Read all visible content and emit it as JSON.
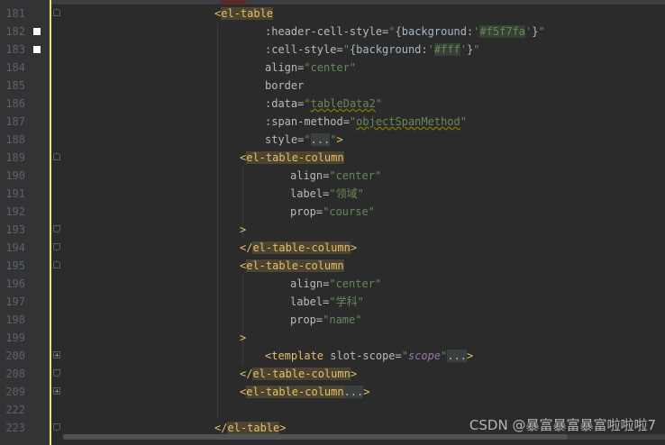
{
  "lines": [
    {
      "num": "181",
      "indent": "",
      "parts": [
        {
          "t": "<",
          "c": "tag"
        },
        {
          "t": "el-table",
          "c": "tag tag-bg"
        }
      ]
    },
    {
      "num": "182",
      "bookmark": true,
      "parts": [
        {
          "t": ":header-cell-style=",
          "c": "attr"
        },
        {
          "t": "\"",
          "c": "str"
        },
        {
          "t": "{background:",
          "c": "brace"
        },
        {
          "t": "'",
          "c": "jsstr"
        },
        {
          "t": "#f5f7fa",
          "c": "jsstr hex"
        },
        {
          "t": "'",
          "c": "jsstr"
        },
        {
          "t": "}",
          "c": "brace"
        },
        {
          "t": "\"",
          "c": "str"
        }
      ]
    },
    {
      "num": "183",
      "bookmark": true,
      "parts": [
        {
          "t": ":cell-style=",
          "c": "attr"
        },
        {
          "t": "\"",
          "c": "str"
        },
        {
          "t": "{background:",
          "c": "brace"
        },
        {
          "t": "'",
          "c": "jsstr"
        },
        {
          "t": "#fff",
          "c": "jsstr hex"
        },
        {
          "t": "'",
          "c": "jsstr"
        },
        {
          "t": "}",
          "c": "brace"
        },
        {
          "t": "\"",
          "c": "str"
        }
      ]
    },
    {
      "num": "184",
      "parts": [
        {
          "t": "align=",
          "c": "attr"
        },
        {
          "t": "\"center\"",
          "c": "str"
        }
      ]
    },
    {
      "num": "185",
      "parts": [
        {
          "t": "border",
          "c": "attr"
        }
      ]
    },
    {
      "num": "186",
      "parts": [
        {
          "t": ":data=",
          "c": "attr"
        },
        {
          "t": "\"",
          "c": "str"
        },
        {
          "t": "tableData2",
          "c": "str wavy"
        },
        {
          "t": "\"",
          "c": "str"
        }
      ]
    },
    {
      "num": "187",
      "parts": [
        {
          "t": ":span-method=",
          "c": "attr"
        },
        {
          "t": "\"",
          "c": "str"
        },
        {
          "t": "objectSpanMethod",
          "c": "str wavy"
        },
        {
          "t": "\"",
          "c": "str"
        }
      ]
    },
    {
      "num": "188",
      "parts": [
        {
          "t": "style=",
          "c": "attr"
        },
        {
          "t": "\"",
          "c": "str"
        },
        {
          "t": "...",
          "c": "fold-dots"
        },
        {
          "t": "\"",
          "c": "str"
        },
        {
          "t": ">",
          "c": "tag"
        }
      ]
    },
    {
      "num": "189",
      "parts": [
        {
          "t": "<",
          "c": "tag"
        },
        {
          "t": "el-table-column",
          "c": "tag tag-bg"
        }
      ]
    },
    {
      "num": "190",
      "parts": [
        {
          "t": "align=",
          "c": "attr"
        },
        {
          "t": "\"center\"",
          "c": "str"
        }
      ]
    },
    {
      "num": "191",
      "parts": [
        {
          "t": "label=",
          "c": "attr"
        },
        {
          "t": "\"领域\"",
          "c": "str"
        }
      ]
    },
    {
      "num": "192",
      "parts": [
        {
          "t": "prop=",
          "c": "attr"
        },
        {
          "t": "\"course\"",
          "c": "str"
        }
      ]
    },
    {
      "num": "193",
      "parts": [
        {
          "t": ">",
          "c": "tag"
        }
      ]
    },
    {
      "num": "194",
      "parts": [
        {
          "t": "</",
          "c": "tag"
        },
        {
          "t": "el-table-column",
          "c": "tag tag-bg"
        },
        {
          "t": ">",
          "c": "tag"
        }
      ]
    },
    {
      "num": "195",
      "parts": [
        {
          "t": "<",
          "c": "tag"
        },
        {
          "t": "el-table-column",
          "c": "tag tag-bg"
        }
      ]
    },
    {
      "num": "196",
      "parts": [
        {
          "t": "align=",
          "c": "attr"
        },
        {
          "t": "\"center\"",
          "c": "str"
        }
      ]
    },
    {
      "num": "197",
      "parts": [
        {
          "t": "label=",
          "c": "attr"
        },
        {
          "t": "\"学科\"",
          "c": "str"
        }
      ]
    },
    {
      "num": "198",
      "parts": [
        {
          "t": "prop=",
          "c": "attr"
        },
        {
          "t": "\"name\"",
          "c": "str"
        }
      ]
    },
    {
      "num": "199",
      "parts": [
        {
          "t": ">",
          "c": "tag"
        }
      ]
    },
    {
      "num": "200",
      "parts": [
        {
          "t": "<",
          "c": "tag"
        },
        {
          "t": "template ",
          "c": "tag"
        },
        {
          "t": "slot-scope=",
          "c": "attr"
        },
        {
          "t": "\"",
          "c": "str"
        },
        {
          "t": "scope",
          "c": "italic"
        },
        {
          "t": "\"",
          "c": "str"
        },
        {
          "t": "...",
          "c": "fold-dots"
        },
        {
          "t": ">",
          "c": "tag"
        }
      ]
    },
    {
      "num": "208",
      "parts": [
        {
          "t": "</",
          "c": "tag"
        },
        {
          "t": "el-table-column",
          "c": "tag tag-bg"
        },
        {
          "t": ">",
          "c": "tag"
        }
      ]
    },
    {
      "num": "209",
      "parts": [
        {
          "t": "<",
          "c": "tag"
        },
        {
          "t": "el-table-column",
          "c": "tag tag-bg"
        },
        {
          "t": "...",
          "c": "fold-dots"
        },
        {
          "t": ">",
          "c": "tag"
        }
      ]
    },
    {
      "num": "222",
      "parts": []
    },
    {
      "num": "223",
      "parts": [
        {
          "t": "</",
          "c": "tag"
        },
        {
          "t": "el-table",
          "c": "tag tag-bg"
        },
        {
          "t": ">",
          "c": "tag"
        }
      ]
    }
  ],
  "watermark": "CSDN @暴富暴富暴富啦啦啦7"
}
